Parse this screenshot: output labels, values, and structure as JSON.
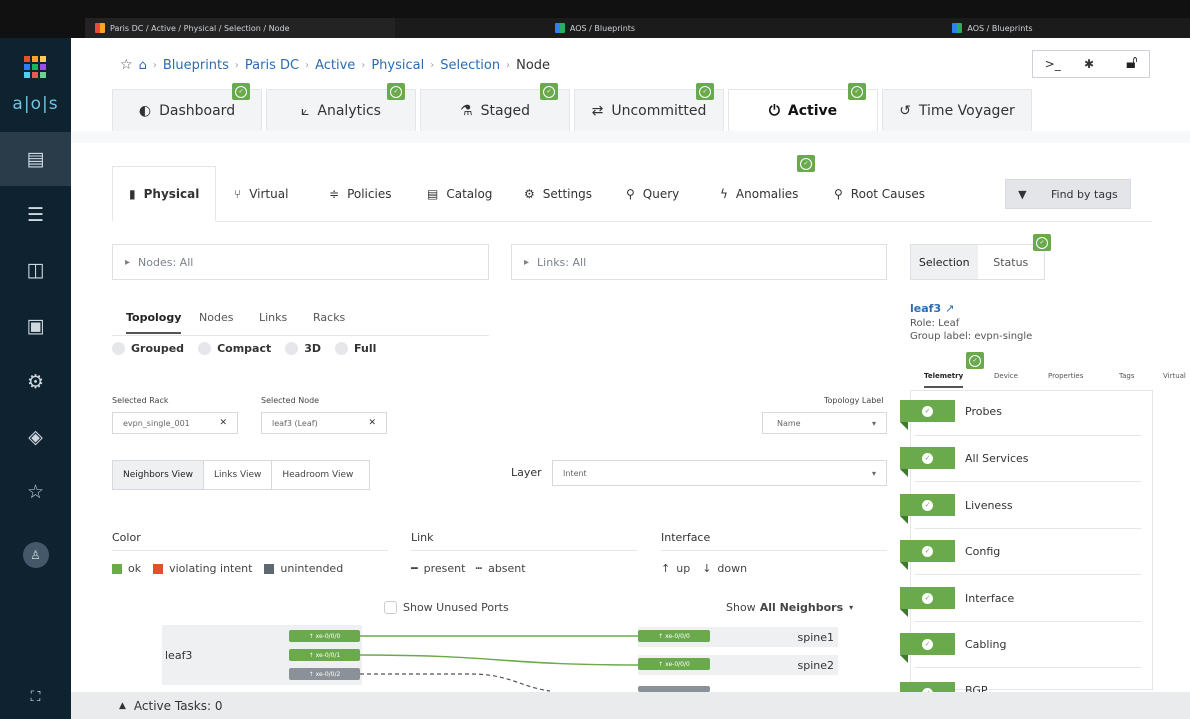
{
  "browser": {
    "tabs": [
      {
        "title": "Paris DC / Active / Physical / Selection / Node"
      },
      {
        "title": "AOS / Blueprints"
      },
      {
        "title": "AOS / Blueprints"
      }
    ]
  },
  "sidebar": {
    "brand": "a|o|s",
    "items": [
      {
        "icon": "blueprints-icon"
      },
      {
        "icon": "devices-icon"
      },
      {
        "icon": "design-icon"
      },
      {
        "icon": "resources-icon"
      },
      {
        "icon": "external-systems-icon"
      },
      {
        "icon": "platform-icon"
      },
      {
        "icon": "favorites-icon"
      },
      {
        "icon": "user-icon"
      }
    ],
    "expand_icon": "fullscreen-icon"
  },
  "breadcrumb": {
    "items": [
      "Blueprints",
      "Paris DC",
      "Active",
      "Physical",
      "Selection"
    ],
    "current": "Node"
  },
  "header_tools": {
    "terminal": ">_",
    "bug": "✱"
  },
  "nav_tabs": [
    {
      "label": "Dashboard",
      "icon": "dashboard-icon"
    },
    {
      "label": "Analytics",
      "icon": "analytics-icon"
    },
    {
      "label": "Staged",
      "icon": "staged-icon"
    },
    {
      "label": "Uncommitted",
      "icon": "uncommitted-icon"
    },
    {
      "label": "Active",
      "icon": "power-icon"
    },
    {
      "label": "Time Voyager",
      "icon": "history-icon"
    }
  ],
  "sub_tabs": [
    {
      "label": "Physical"
    },
    {
      "label": "Virtual"
    },
    {
      "label": "Policies"
    },
    {
      "label": "Catalog"
    },
    {
      "label": "Settings"
    },
    {
      "label": "Query"
    },
    {
      "label": "Anomalies"
    },
    {
      "label": "Root Causes"
    }
  ],
  "find_by_tags": "Find by tags",
  "filters": {
    "nodes": "Nodes: All",
    "links": "Links: All"
  },
  "view_tabs": [
    "Topology",
    "Nodes",
    "Links",
    "Racks"
  ],
  "layouts": [
    "Grouped",
    "Compact",
    "3D",
    "Full"
  ],
  "selected_rack": {
    "label": "Selected Rack",
    "value": "evpn_single_001"
  },
  "selected_node": {
    "label": "Selected Node",
    "value": "leaf3 (Leaf)"
  },
  "topology_label": {
    "label": "Topology Label",
    "value": "Name"
  },
  "views": [
    "Neighbors View",
    "Links View",
    "Headroom View"
  ],
  "layer": {
    "label": "Layer",
    "value": "Intent"
  },
  "legend": {
    "color_title": "Color",
    "link_title": "Link",
    "interface_title": "Interface",
    "colors": [
      {
        "label": "ok",
        "color": "#6aaa4d"
      },
      {
        "label": "violating intent",
        "color": "#e0502e"
      },
      {
        "label": "unintended",
        "color": "#5f6770"
      }
    ],
    "links": [
      "present",
      "absent"
    ],
    "interfaces": [
      "up",
      "down"
    ]
  },
  "show_unused_ports": "Show Unused Ports",
  "show_neighbors": {
    "prefix": "Show",
    "value": "All Neighbors"
  },
  "topology": {
    "node": "leaf3",
    "ports": [
      "xe-0/0/0",
      "xe-0/0/1",
      "xe-0/0/2"
    ],
    "neighbors": [
      {
        "port": "xe-0/0/0",
        "name": "spine1"
      },
      {
        "port": "xe-0/0/0",
        "name": "spine2"
      }
    ]
  },
  "selection_panel": {
    "tabs": [
      "Selection",
      "Status"
    ],
    "node_name": "leaf3",
    "role": "Role: Leaf",
    "group_label": "Group label: evpn-single",
    "inner_tabs": [
      "Telemetry",
      "Device",
      "Properties",
      "Tags",
      "Virtual"
    ],
    "telemetry": [
      "Probes",
      "All Services",
      "Liveness",
      "Config",
      "Interface",
      "Cabling",
      "BGP"
    ]
  },
  "footer": {
    "label": "Active Tasks: 0"
  }
}
